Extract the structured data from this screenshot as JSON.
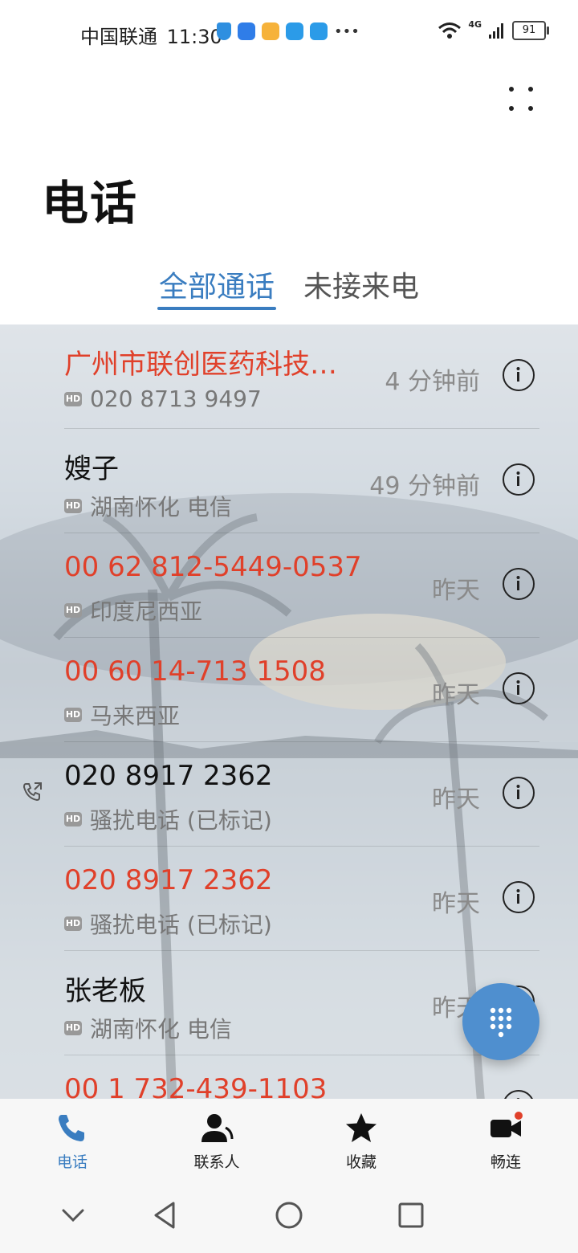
{
  "status_bar": {
    "carrier": "中国联通",
    "time": "11:30",
    "network": "4G",
    "battery": "91"
  },
  "header": {
    "title": "电话"
  },
  "tabs": [
    {
      "label": "全部通话",
      "active": true
    },
    {
      "label": "未接来电",
      "active": false
    }
  ],
  "calls": [
    {
      "name": "广州市联创医药科技…",
      "subtitle": "020 8713 9497",
      "time": "4 分钟前",
      "missed": true,
      "outgoing": false
    },
    {
      "name": "嫂子",
      "subtitle": "湖南怀化 电信",
      "time": "49 分钟前",
      "missed": false,
      "outgoing": false
    },
    {
      "name": "00 62 812-5449-0537",
      "subtitle": "印度尼西亚",
      "time": "昨天",
      "missed": true,
      "outgoing": false
    },
    {
      "name": "00 60 14-713 1508",
      "subtitle": "马来西亚",
      "time": "昨天",
      "missed": true,
      "outgoing": false
    },
    {
      "name": "020 8917 2362",
      "subtitle": "骚扰电话 (已标记)",
      "time": "昨天",
      "missed": false,
      "outgoing": true
    },
    {
      "name": "020 8917 2362",
      "subtitle": "骚扰电话 (已标记)",
      "time": "昨天",
      "missed": true,
      "outgoing": false
    },
    {
      "name": "张老板",
      "subtitle": "湖南怀化 电信",
      "time": "昨天",
      "missed": false,
      "outgoing": false
    },
    {
      "name": "00 1 732-439-1103",
      "subtitle": "",
      "time": "",
      "missed": true,
      "outgoing": false
    }
  ],
  "hd_badge": "HD",
  "bottom_nav": [
    {
      "label": "电话",
      "icon": "phone-icon",
      "active": true
    },
    {
      "label": "联系人",
      "icon": "contacts-icon",
      "active": false
    },
    {
      "label": "收藏",
      "icon": "star-icon",
      "active": false
    },
    {
      "label": "畅连",
      "icon": "video-call-icon",
      "active": false
    }
  ],
  "colors": {
    "accent": "#3a7dc0",
    "missed": "#e0402a",
    "fab": "#4f8fcf"
  }
}
